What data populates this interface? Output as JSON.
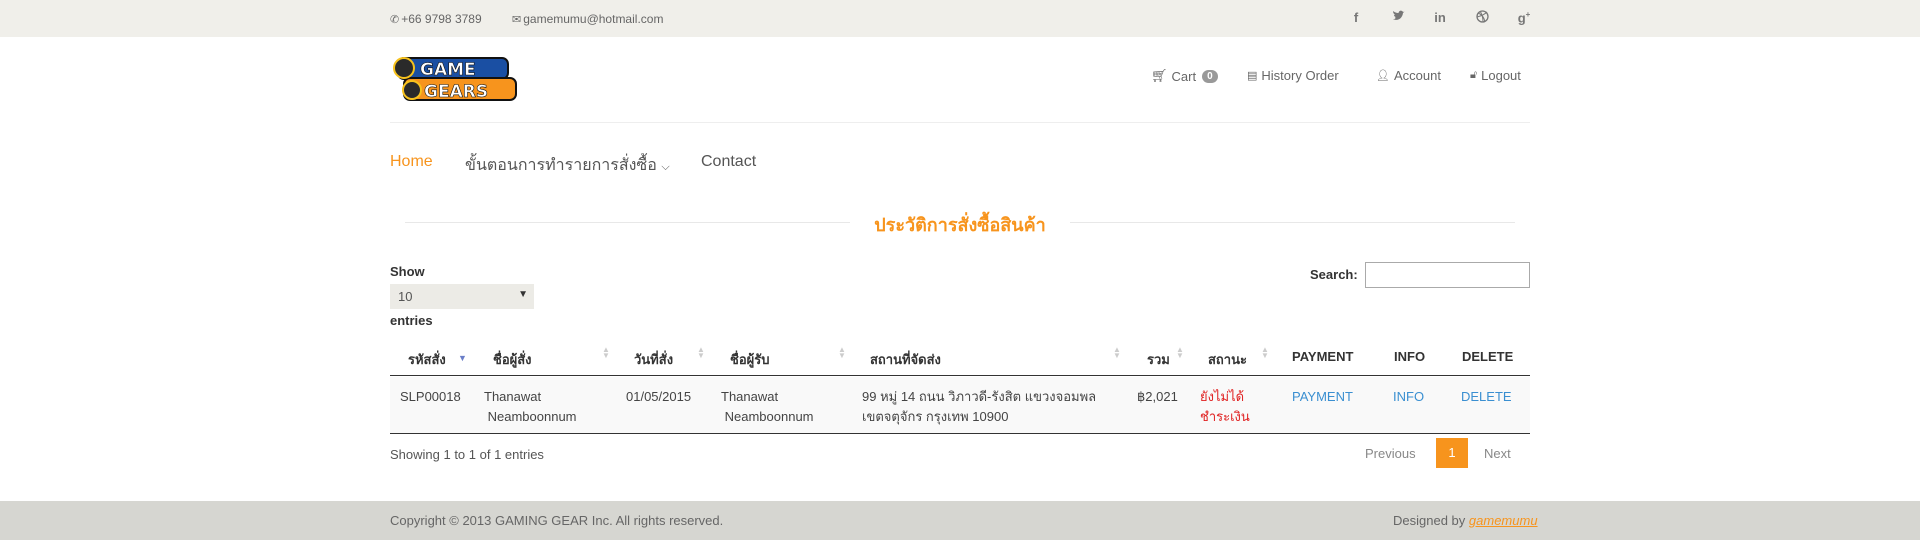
{
  "topbar": {
    "phone": "+66 9798 3789",
    "email": "gamemumu@hotmail.com",
    "social": [
      "facebook-icon",
      "twitter-icon",
      "linkedin-icon",
      "dribbble-icon",
      "google-plus-icon"
    ]
  },
  "logo": {
    "line1": "GAME",
    "line2": "GEARS"
  },
  "usernav": {
    "cart": "Cart",
    "cart_count": "0",
    "history": "History Order",
    "account": "Account",
    "logout": "Logout"
  },
  "mainnav": {
    "home": "Home",
    "steps": "ขั้นตอนการทำรายการสั่งซื้อ",
    "contact": "Contact"
  },
  "section_title": "ประวัติการสั่งซื้อสินค้า",
  "controls": {
    "show_label": "Show",
    "page_size": "10",
    "entries_label": "entries",
    "search_label": "Search:"
  },
  "table": {
    "headers": [
      "รหัสสั่ง",
      "ชื่อผู้สั่ง",
      "วันที่สั่ง",
      "ชื่อผู้รับ",
      "สถานที่จัดส่ง",
      "รวม",
      "สถานะ",
      "PAYMENT",
      "INFO",
      "DELETE"
    ],
    "rows": [
      {
        "id": "SLP00018",
        "orderer_1": "Thanawat",
        "orderer_2": "Neamboonnum",
        "date": "01/05/2015",
        "receiver_1": "Thanawat",
        "receiver_2": "Neamboonnum",
        "address_1": "99 หมู่ 14 ถนน วิภาวดี-รังสิต แขวงจอมพล",
        "address_2": "เขตจตุจักร กรุงเทพ 10900",
        "total": "฿2,021",
        "status_1": "ยังไม่ได้",
        "status_2": "ชำระเงิน",
        "payment": "PAYMENT",
        "info": "INFO",
        "delete": "DELETE"
      }
    ]
  },
  "pagination": {
    "summary": "Showing 1 to 1 of 1 entries",
    "previous": "Previous",
    "current": "1",
    "next": "Next"
  },
  "footer": {
    "copyright": "Copyright © 2013 GAMING GEAR Inc. All rights reserved.",
    "designed_by": "Designed by",
    "designer": "gamemumu"
  },
  "colors": {
    "accent": "#f7941d",
    "link": "#3a8fd1",
    "status": "#e02020"
  }
}
